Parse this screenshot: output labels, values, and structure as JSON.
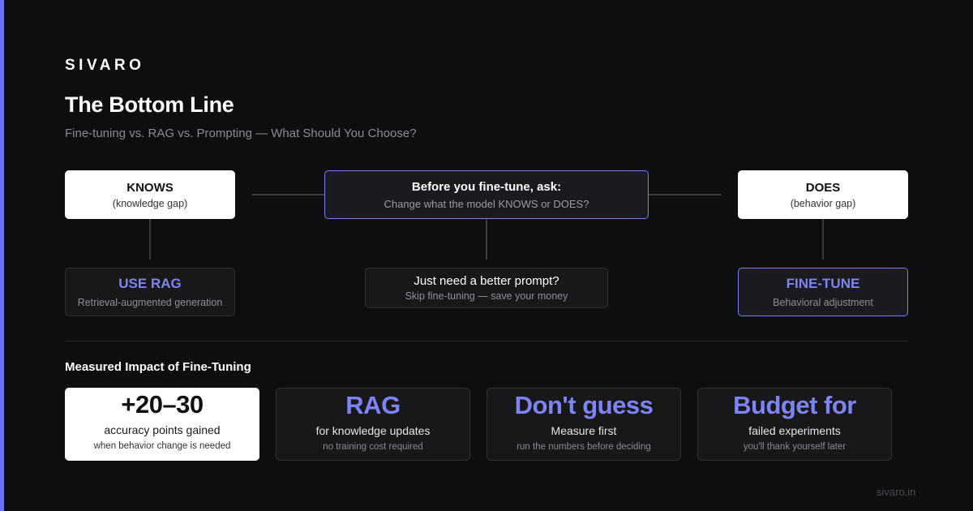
{
  "brand": "SIVARO",
  "title": "The Bottom Line",
  "subtitle": "Fine-tuning vs. RAG vs. Prompting — What Should You Choose?",
  "diagram": {
    "knows": {
      "label": "KNOWS",
      "sub": "(knowledge gap)"
    },
    "question": {
      "label": "Before you fine-tune, ask:",
      "sub": "Change what the model KNOWS or DOES?"
    },
    "does": {
      "label": "DOES",
      "sub": "(behavior gap)"
    },
    "use_rag": {
      "label": "USE RAG",
      "sub": "Retrieval-augmented generation"
    },
    "prompt": {
      "label": "Just need a better prompt?",
      "sub": "Skip fine-tuning — save your money"
    },
    "fine_tune": {
      "label": "FINE-TUNE",
      "sub": "Behavioral adjustment"
    }
  },
  "impact": {
    "title": "Measured Impact of Fine-Tuning",
    "stats": [
      {
        "value": "+20–30",
        "label": "accuracy points gained",
        "note": "when behavior change is needed"
      },
      {
        "value": "RAG",
        "label": "for knowledge updates",
        "note": "no training cost required"
      },
      {
        "value": "Don't guess",
        "label": "Measure first",
        "note": "run the numbers before deciding"
      },
      {
        "value": "Budget for",
        "label": "failed experiments",
        "note": "you'll thank yourself later"
      }
    ]
  },
  "footer": {
    "url": "sivaro.in"
  },
  "colors": {
    "accent": "#7e84f3",
    "background": "#0e0e10",
    "card_dark": "#18181b"
  }
}
